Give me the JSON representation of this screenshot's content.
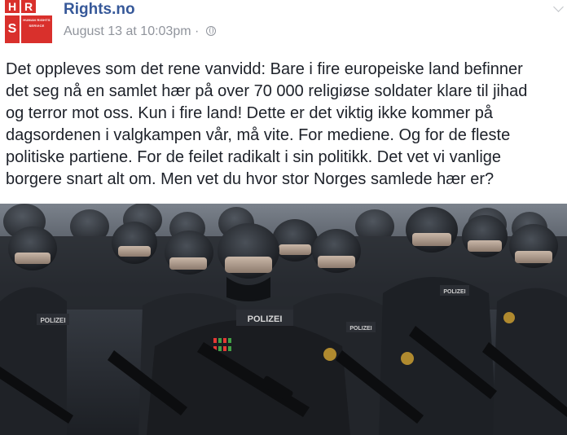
{
  "logo": {
    "letters": [
      "H",
      "R",
      "S"
    ],
    "tagline": "HUMAN RIGHTS SERVICE",
    "brand_color": "#d9302c"
  },
  "page": {
    "name": "Rights.no",
    "timestamp": "August 13 at 10:03pm",
    "separator": "·",
    "privacy_icon": "globe-icon"
  },
  "post": {
    "text": "Det oppleves som det rene vanvidd: Bare i fire europeiske land befinner\ndet seg nå en samlet hær på over 70 000 religiøse soldater klare til jihad\nog terror mot oss. Kun i fire land! Dette er det viktig ikke kommer på\ndagsordenen i valgkampen vår, må vite. For mediene. Og for de fleste\npolitiske partiene. For de feilet radikalt i sin politikk. Det vet vi vanlige\nborgere snart alt om. Men vet du hvor stor Norges samlede hær er?"
  },
  "photo": {
    "patch_label": "POLIZEI"
  }
}
